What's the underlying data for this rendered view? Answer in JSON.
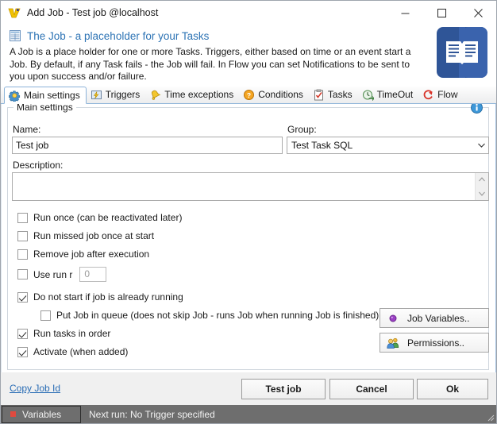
{
  "window": {
    "title": "Add Job - Test job @localhost",
    "icon": "app-logo-icon",
    "minimize_label": "Minimize",
    "maximize_label": "Maximize",
    "close_label": "Close"
  },
  "header": {
    "title": "The Job - a placeholder for your Tasks",
    "description": "A Job is a place holder for one or more Tasks. Triggers, either based on time or an event start a Job. By default, if any Task fails - the Job will fail. In Flow you can set Notifications to be sent to you upon success and/or failure.",
    "icon": "grid-document-icon",
    "big_icon": "open-book-icon"
  },
  "tabs": [
    {
      "label": "Main settings",
      "icon": "gear-icon",
      "active": true
    },
    {
      "label": "Triggers",
      "icon": "lightning-icon",
      "active": false
    },
    {
      "label": "Time exceptions",
      "icon": "bell-icon",
      "active": false
    },
    {
      "label": "Conditions",
      "icon": "question-icon",
      "active": false
    },
    {
      "label": "Tasks",
      "icon": "clipboard-icon",
      "active": false
    },
    {
      "label": "TimeOut",
      "icon": "clock-icon",
      "active": false
    },
    {
      "label": "Flow",
      "icon": "flow-arrow-icon",
      "active": false
    }
  ],
  "main_settings": {
    "group_legend": "Main settings",
    "info_icon": "info-icon",
    "name_label": "Name:",
    "name_value": "Test job",
    "name_placeholder": "",
    "group_label": "Group:",
    "group_value": "Test Task SQL",
    "description_label": "Description:",
    "description_value": "",
    "description_placeholder": "",
    "checkboxes": [
      {
        "label": "Run once (can be reactivated later)",
        "checked": false
      },
      {
        "label": "Run missed job once at start",
        "checked": false
      },
      {
        "label": "Remove job after execution",
        "checked": false
      },
      {
        "label": "Use run r",
        "checked": false,
        "number_value": "0"
      },
      {
        "label": "Do not start if job is already running",
        "checked": true
      },
      {
        "label": "Put Job in queue (does not skip Job - runs Job when running Job is finished)",
        "checked": false
      },
      {
        "label": "Run tasks in order",
        "checked": true
      },
      {
        "label": "Activate (when added)",
        "checked": true
      }
    ],
    "side_buttons": [
      {
        "label": "Job Variables..",
        "icon": "purple-dot-icon"
      },
      {
        "label": "Permissions..",
        "icon": "users-icon"
      }
    ]
  },
  "footer": {
    "copy_link": "Copy Job Id",
    "buttons": [
      {
        "label": "Test job"
      },
      {
        "label": "Cancel"
      },
      {
        "label": "Ok"
      }
    ]
  },
  "statusbar": {
    "variables_label": "Variables",
    "next_run_text": "Next run: No Trigger specified"
  },
  "colors": {
    "accent_blue": "#2e74b5",
    "tab_border": "#8cb3d9",
    "status_bg": "#6e6e6e",
    "link": "#2a6db5",
    "book_icon": "#2f5597"
  }
}
